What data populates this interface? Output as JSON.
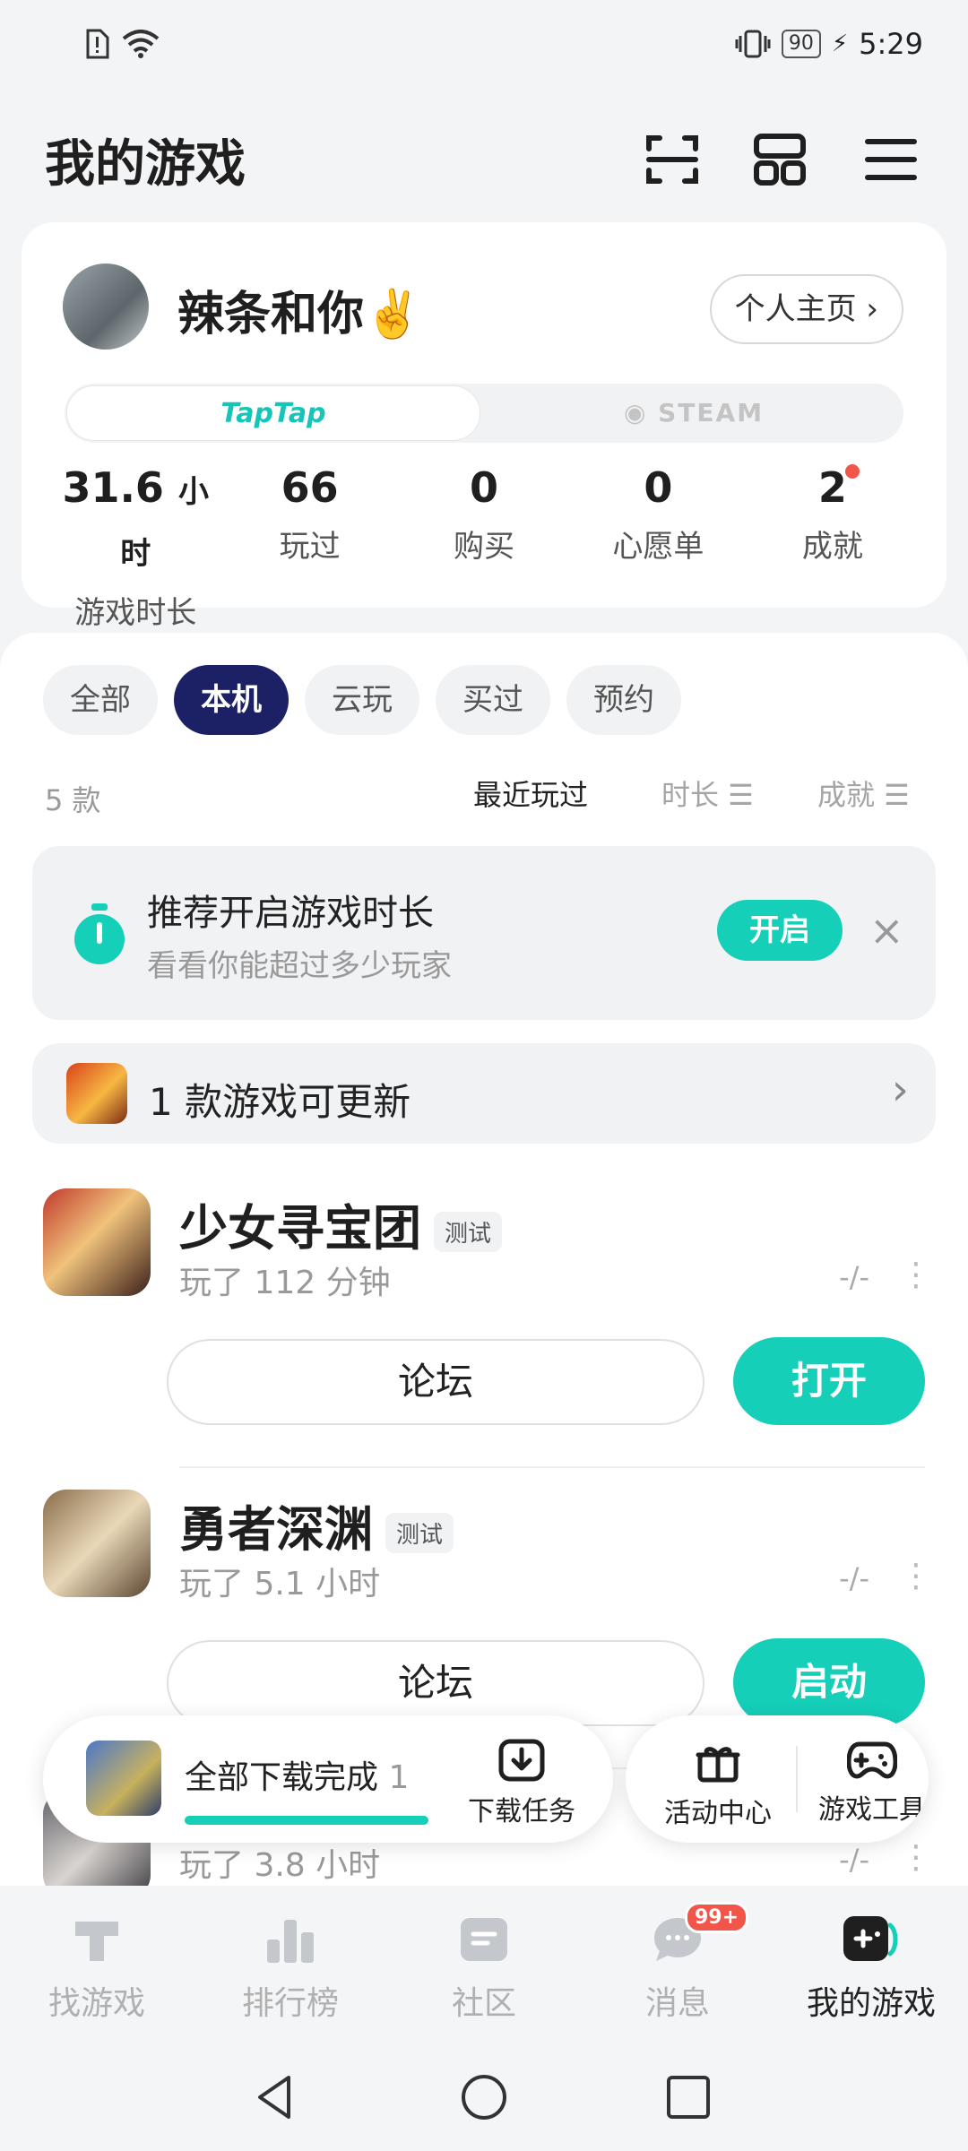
{
  "status_bar": {
    "time": "5:29",
    "battery": "90"
  },
  "header": {
    "title": "我的游戏"
  },
  "profile": {
    "username": "辣条和你✌️",
    "home_button": "个人主页 ›",
    "platform_tabs": [
      "TapTap",
      "STEAM"
    ],
    "stats": [
      {
        "value": "31.6",
        "unit": "小时",
        "label": "游戏时长"
      },
      {
        "value": "66",
        "unit": "",
        "label": "玩过"
      },
      {
        "value": "0",
        "unit": "",
        "label": "购买"
      },
      {
        "value": "0",
        "unit": "",
        "label": "心愿单"
      },
      {
        "value": "2",
        "unit": "",
        "label": "成就"
      }
    ]
  },
  "filters": {
    "chips": [
      "全部",
      "本机",
      "云玩",
      "买过",
      "预约"
    ],
    "active": "本机"
  },
  "sort": {
    "count": "5 款",
    "options": [
      "最近玩过",
      "时长 ☰",
      "成就 ☰"
    ]
  },
  "tip": {
    "title": "推荐开启游戏时长",
    "subtitle": "看看你能超过多少玩家",
    "button": "开启",
    "close": "×"
  },
  "update": {
    "text": "1 款游戏可更新"
  },
  "games": [
    {
      "name": "少女寻宝团",
      "tag": "测试",
      "played": "玩了 112 分钟",
      "rating": "-/-",
      "forum": "论坛",
      "action": "打开"
    },
    {
      "name": "勇者深渊",
      "tag": "测试",
      "played": "玩了 5.1 小时",
      "rating": "-/-",
      "forum": "论坛",
      "action": "启动"
    },
    {
      "name": "",
      "tag": "",
      "played": "玩了 3.8 小时",
      "rating": "-/-",
      "forum": "",
      "action": ""
    }
  ],
  "download": {
    "status": "全部下载完成",
    "task_label": "下载任务",
    "count": "1"
  },
  "activity": {
    "center": "活动中心",
    "tools": "游戏工具"
  },
  "tabbar": {
    "items": [
      "找游戏",
      "排行榜",
      "社区",
      "消息",
      "我的游戏"
    ],
    "active": "我的游戏",
    "message_badge": "99+"
  },
  "colors": {
    "accent": "#15cfb9",
    "active_chip": "#1b2164",
    "badge": "#f2554a"
  }
}
